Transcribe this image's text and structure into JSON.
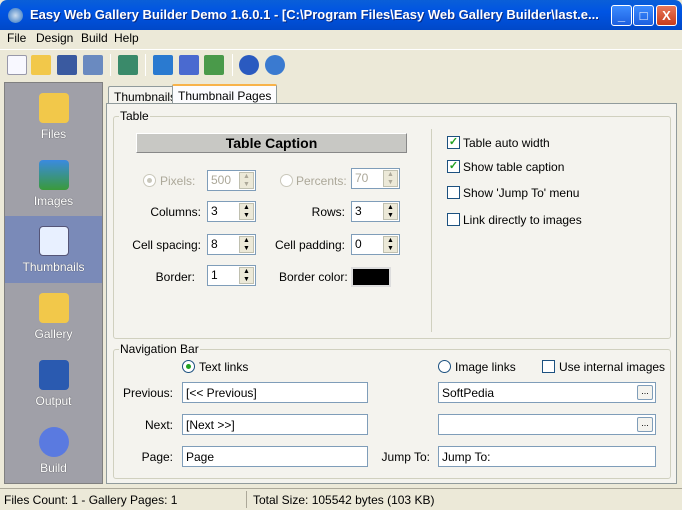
{
  "window": {
    "title": "Easy Web Gallery Builder Demo 1.6.0.1 - [C:\\Program Files\\Easy Web Gallery Builder\\last.e...",
    "minimize": "_",
    "maximize": "□",
    "close": "X"
  },
  "menu": [
    "File",
    "Design",
    "Build",
    "Help"
  ],
  "toolbar": [
    "new-icon",
    "open-icon",
    "save-icon",
    "save-as-icon",
    "add-list-icon",
    "preview-icon",
    "grid-icon",
    "build-icon",
    "help-icon",
    "info-icon"
  ],
  "sidebar": [
    {
      "label": "Files"
    },
    {
      "label": "Images"
    },
    {
      "label": "Thumbnails"
    },
    {
      "label": "Gallery"
    },
    {
      "label": "Output"
    },
    {
      "label": "Build"
    }
  ],
  "tabs": [
    "Thumbnails",
    "Thumbnail Pages"
  ],
  "table": {
    "group": "Table",
    "caption": "Table Caption",
    "pixels_label": "Pixels:",
    "pixels": "500",
    "percents_label": "Percents:",
    "percents": "70",
    "columns_label": "Columns:",
    "columns": "3",
    "rows_label": "Rows:",
    "rows": "3",
    "spacing_label": "Cell spacing:",
    "spacing": "8",
    "padding_label": "Cell padding:",
    "padding": "0",
    "border_label": "Border:",
    "border": "1",
    "border_color_label": "Border color:",
    "border_color": "#000000",
    "checks": [
      {
        "label": "Table auto width",
        "checked": true
      },
      {
        "label": "Show table caption",
        "checked": true
      },
      {
        "label": "Show 'Jump To' menu",
        "checked": false
      },
      {
        "label": "Link directly to images",
        "checked": false
      }
    ]
  },
  "nav": {
    "group": "Navigation Bar",
    "text_links": "Text links",
    "image_links": "Image links",
    "internal": "Use internal images",
    "previous_label": "Previous:",
    "previous": "[<< Previous]",
    "previous_img": "SoftPedia",
    "next_label": "Next:",
    "next": "[Next >>]",
    "next_img": "",
    "page_label": "Page:",
    "page": "Page",
    "jump_label": "Jump To:",
    "jump": "Jump To:",
    "browse": "..."
  },
  "status": {
    "left": "Files Count: 1 - Gallery Pages: 1",
    "right": "Total Size: 105542 bytes (103 KB)"
  }
}
